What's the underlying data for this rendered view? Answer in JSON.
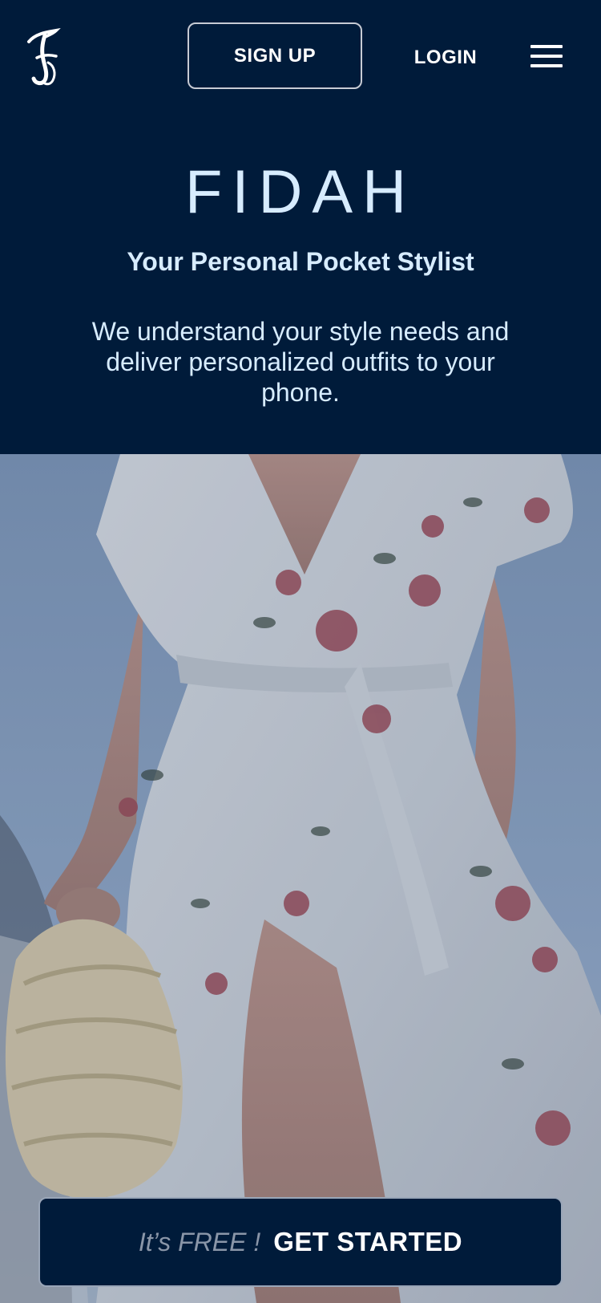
{
  "header": {
    "logo_alt": "F",
    "signup_label": "SIGN UP",
    "login_label": "LOGIN"
  },
  "hero_text": {
    "brand": "FIDAH",
    "tagline": "Your Personal Pocket Stylist",
    "description": "We understand your style needs and deliver personalized outfits to your phone."
  },
  "cta": {
    "free_text": "It’s FREE !",
    "button_label": "GET STARTED"
  },
  "colors": {
    "background": "#001b3a",
    "heading_text": "#d7ecff",
    "button_border": "#c7cbd4"
  },
  "icons": {
    "logo": "fidah-logo-icon",
    "menu": "hamburger-menu-icon"
  }
}
